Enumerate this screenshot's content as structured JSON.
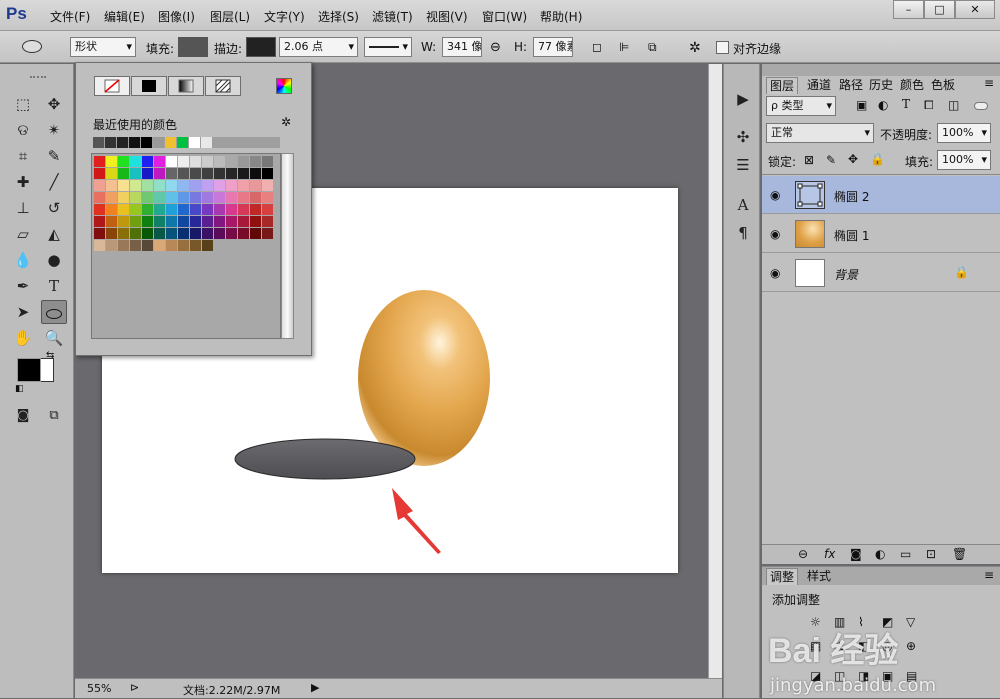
{
  "app": {
    "logo": "Ps"
  },
  "menu": [
    "文件(F)",
    "编辑(E)",
    "图像(I)",
    "图层(L)",
    "文字(Y)",
    "选择(S)",
    "滤镜(T)",
    "视图(V)",
    "窗口(W)",
    "帮助(H)"
  ],
  "window_controls": {
    "minimize": "–",
    "maximize": "□",
    "close": "✕"
  },
  "options": {
    "mode": "形状",
    "fill_label": "填充:",
    "stroke_label": "描边:",
    "stroke_width": "2.06 点",
    "w_label": "W:",
    "w_value": "341 像",
    "h_label": "H:",
    "h_value": "77 像素",
    "align_label": "对齐边缘",
    "fill_color": "#555555",
    "stroke_color": "#222222"
  },
  "popup": {
    "recent_label": "最近使用的颜色",
    "recent_colors": [
      "#555555",
      "#333333",
      "#222222",
      "#111111",
      "#000000",
      "#9a9a9a",
      "#f0c030",
      "#00c040",
      "#ffffff",
      "#e8e8e8"
    ]
  },
  "layers": {
    "tabs": [
      "图层",
      "通道",
      "路径",
      "历史",
      "颜色",
      "色板"
    ],
    "kind_label": "ρ 类型",
    "blend_mode": "正常",
    "opacity_label": "不透明度:",
    "opacity": "100%",
    "lock_label": "锁定:",
    "fill_label": "填充:",
    "fill": "100%",
    "items": [
      {
        "name": "椭圆 2",
        "selected": true
      },
      {
        "name": "椭圆 1",
        "selected": false
      },
      {
        "name": "背景",
        "selected": false
      }
    ],
    "selected_color": "#a8b8dc"
  },
  "adjustments": {
    "tabs": [
      "调整",
      "样式"
    ],
    "title": "添加调整"
  },
  "status": {
    "zoom": "55%",
    "doc": "文档:2.22M/2.97M"
  },
  "watermark": {
    "line1": "Bai 经验",
    "line2": "jingyan.baidu.com"
  }
}
